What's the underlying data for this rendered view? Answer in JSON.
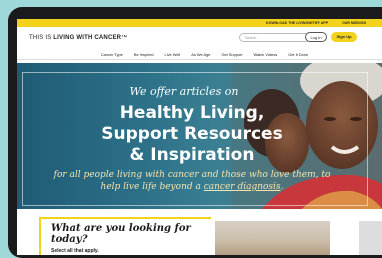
{
  "utility_bar": {
    "link_app": "DOWNLOAD THE LIVINGWITH® APP",
    "link_about": "OUR MISSION"
  },
  "header": {
    "logo_prefix": "THIS IS ",
    "logo_bold": "LIVING WITH CANCER",
    "logo_suffix": "™",
    "search_placeholder": "Search",
    "login_label": "Log In",
    "signup_label": "Sign Up"
  },
  "nav": {
    "items": [
      {
        "label": "Cancer Type"
      },
      {
        "label": "Be Inspired"
      },
      {
        "label": "Live Well"
      },
      {
        "label": "As We Age"
      },
      {
        "label": "Get Support"
      },
      {
        "label": "Watch Videos"
      },
      {
        "label": "Get It Done"
      }
    ]
  },
  "hero": {
    "intro": "We offer articles on",
    "title_line1": "Healthy Living,",
    "title_line2": "Support Resources",
    "title_line3": "& Inspiration",
    "sub_part1": "for all people living with cancer and those who love them, to help live life beyond a ",
    "sub_link": "cancer diagnosis",
    "sub_part2": "."
  },
  "section": {
    "question": "What are you looking for today?",
    "instruction": "Select all that apply."
  },
  "colors": {
    "brand_yellow": "#f2d21b",
    "hero_teal": "#2d7189",
    "device_frame": "#1b1b1d",
    "page_background": "#9fd8d8"
  }
}
